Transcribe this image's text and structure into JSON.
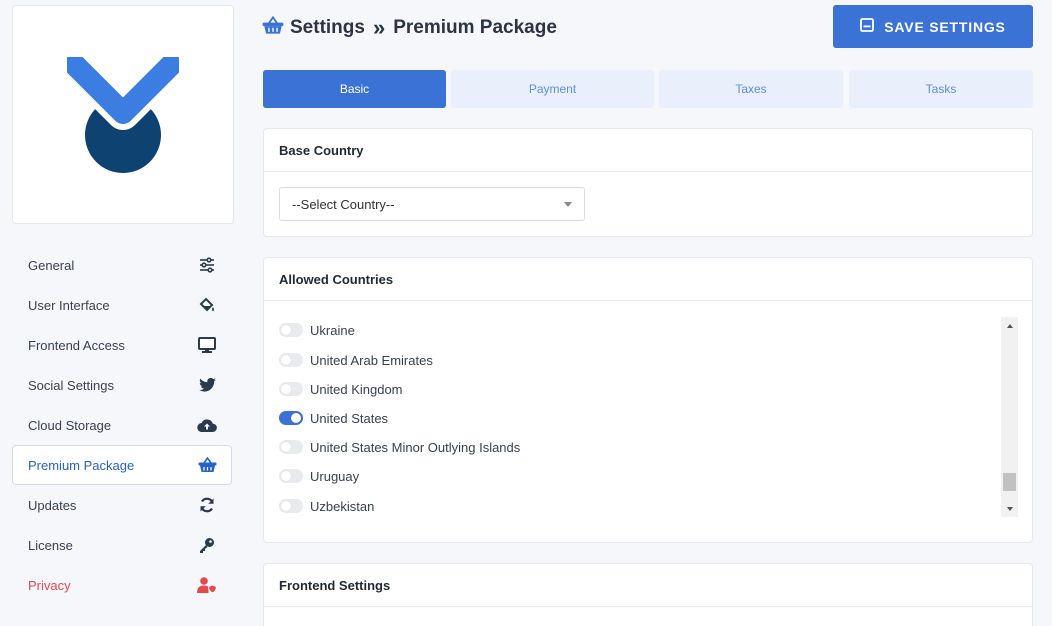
{
  "brand": {
    "logo_icon": "brand-check-logo",
    "colors": {
      "light": "#3b7de0",
      "dark": "#0e4270"
    }
  },
  "sidebar": {
    "items": [
      {
        "label": "General",
        "icon": "sliders-icon"
      },
      {
        "label": "User Interface",
        "icon": "paint-bucket-icon"
      },
      {
        "label": "Frontend Access",
        "icon": "monitor-icon"
      },
      {
        "label": "Social Settings",
        "icon": "twitter-icon"
      },
      {
        "label": "Cloud Storage",
        "icon": "cloud-upload-icon"
      },
      {
        "label": "Premium Package",
        "icon": "basket-icon",
        "active": true
      },
      {
        "label": "Updates",
        "icon": "sync-icon"
      },
      {
        "label": "License",
        "icon": "key-icon"
      },
      {
        "label": "Privacy",
        "icon": "user-shield-icon"
      }
    ]
  },
  "header": {
    "title": "Settings",
    "separator": "»",
    "subtitle": "Premium Package",
    "save_label": "SAVE SETTINGS"
  },
  "tabs": [
    {
      "label": "Basic",
      "active": true
    },
    {
      "label": "Payment"
    },
    {
      "label": "Taxes"
    },
    {
      "label": "Tasks"
    }
  ],
  "base_country": {
    "title": "Base Country",
    "selected": "--Select Country--"
  },
  "allowed_countries": {
    "title": "Allowed Countries",
    "items": [
      {
        "label": "Ukraine",
        "enabled": false
      },
      {
        "label": "United Arab Emirates",
        "enabled": false
      },
      {
        "label": "United Kingdom",
        "enabled": false
      },
      {
        "label": "United States",
        "enabled": true
      },
      {
        "label": "United States Minor Outlying Islands",
        "enabled": false
      },
      {
        "label": "Uruguay",
        "enabled": false
      },
      {
        "label": "Uzbekistan",
        "enabled": false
      }
    ]
  },
  "frontend_settings": {
    "title": "Frontend Settings"
  },
  "colors": {
    "accent": "#3a72d6",
    "tab_bg": "#e9f0fc",
    "danger": "#e5484d",
    "icon": "#2b3a4e"
  }
}
